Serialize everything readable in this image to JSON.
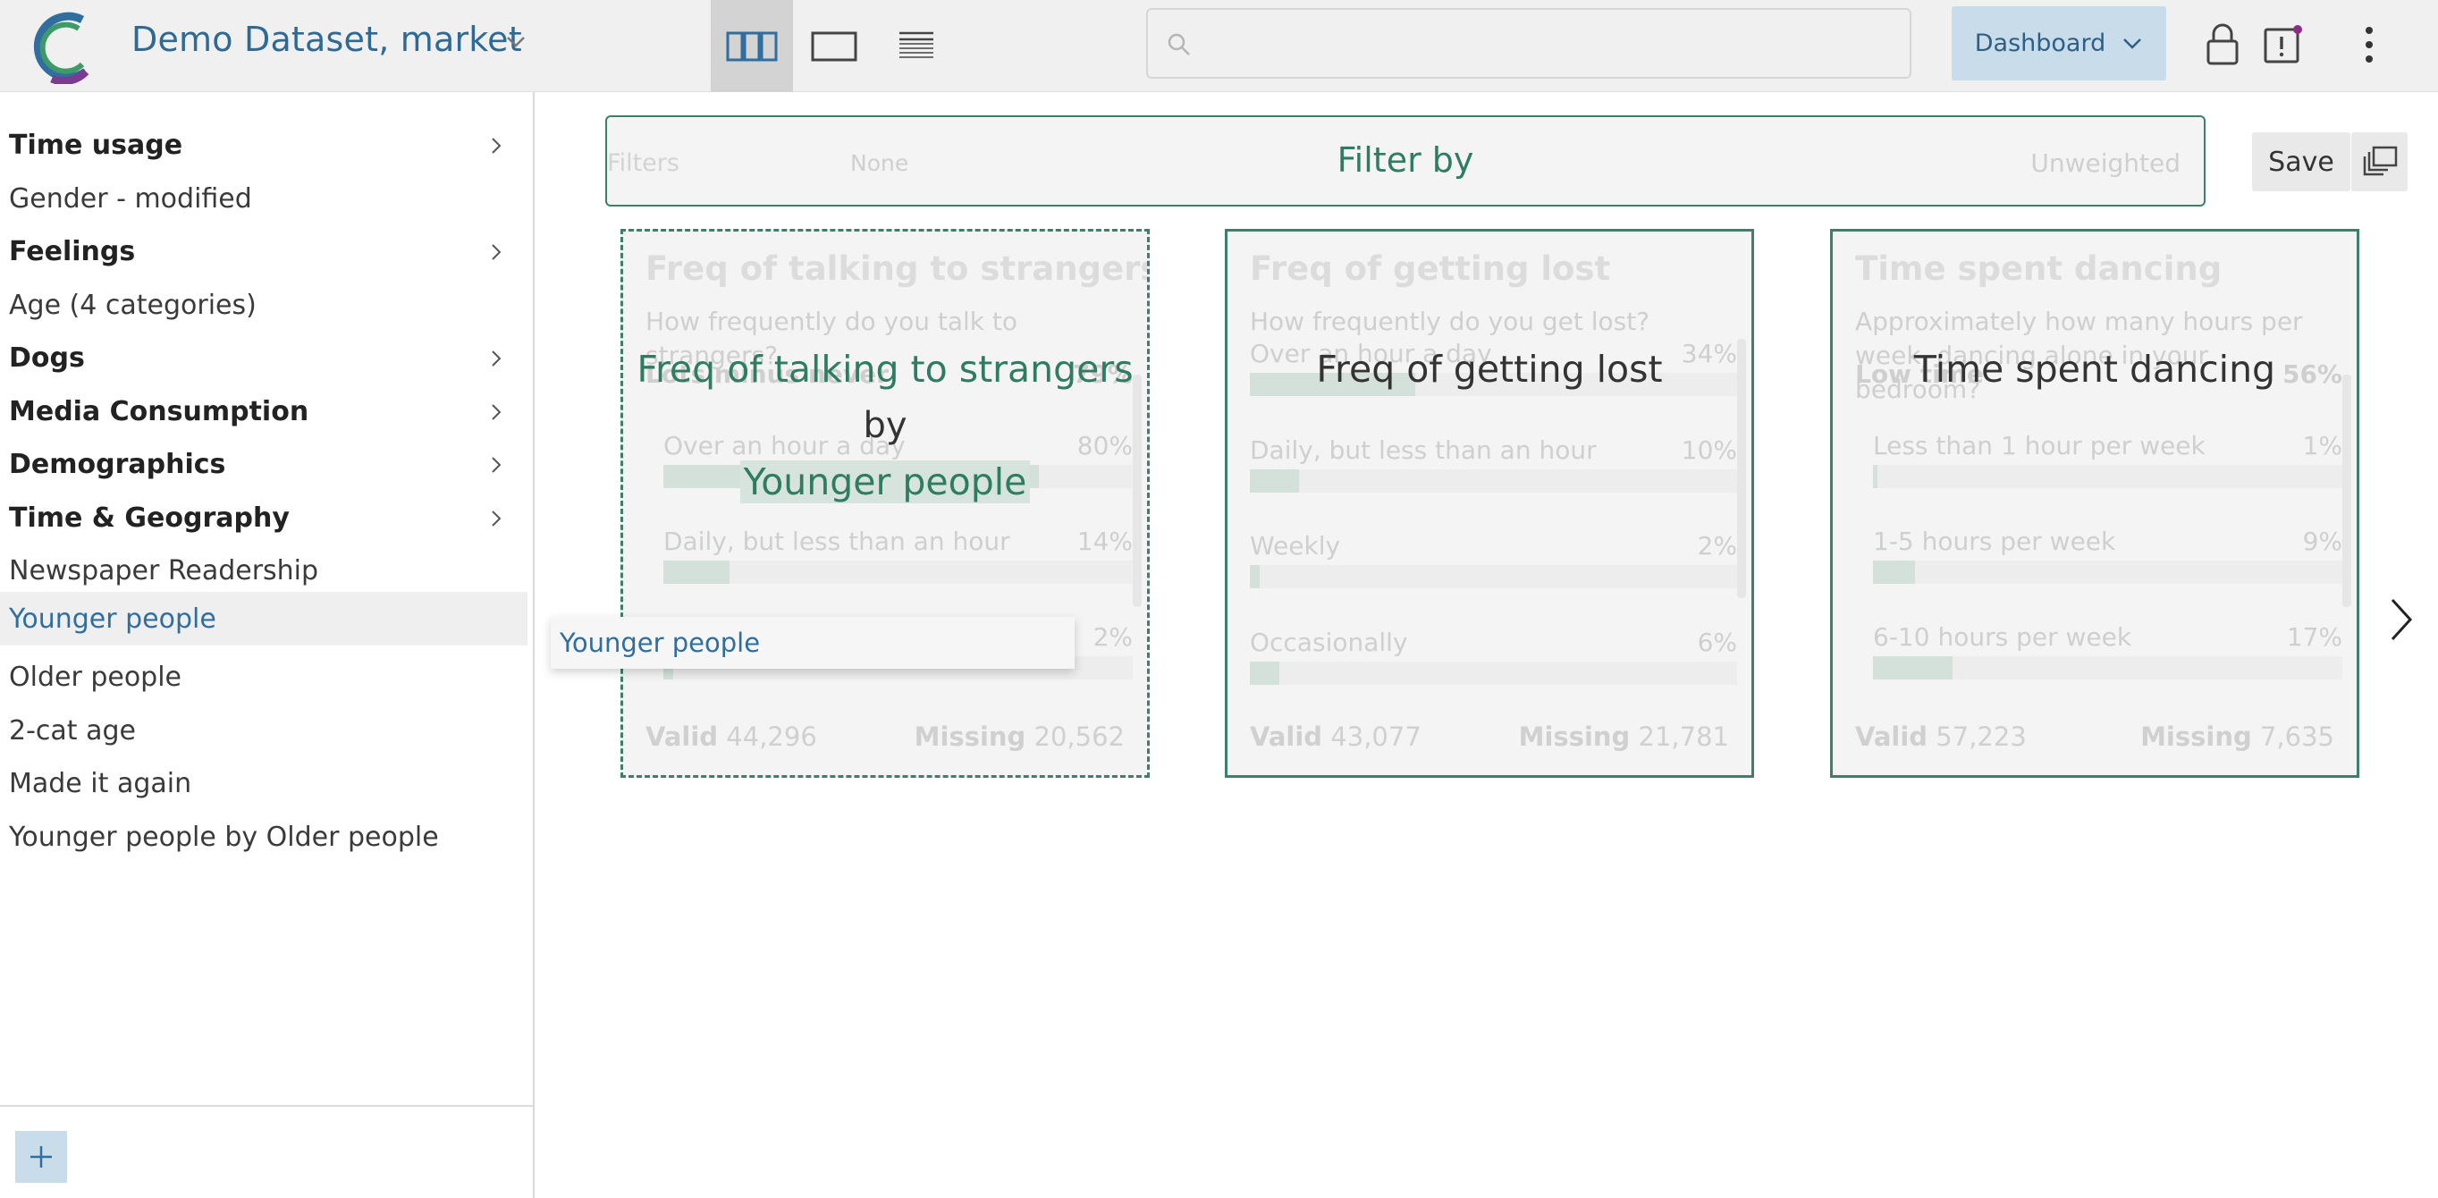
{
  "header": {
    "dataset_name": "Demo Dataset, market",
    "search_placeholder": "",
    "mode_button": "Dashboard",
    "view_modes": [
      "grid-view",
      "single-view",
      "list-view"
    ]
  },
  "sidebar": {
    "items": [
      {
        "label": "Time usage",
        "group": true
      },
      {
        "label": "Gender - modified",
        "group": false
      },
      {
        "label": "Feelings",
        "group": true
      },
      {
        "label": "Age (4 categories)",
        "group": false
      },
      {
        "label": "Dogs",
        "group": true
      },
      {
        "label": "Media Consumption",
        "group": true
      },
      {
        "label": "Demographics",
        "group": true
      },
      {
        "label": "Time & Geography",
        "group": true
      },
      {
        "label": "Newspaper Readership",
        "group": false
      },
      {
        "label": "Younger people",
        "group": false,
        "selected": true
      },
      {
        "label": "Older people",
        "group": false
      },
      {
        "label": "2-cat age",
        "group": false
      },
      {
        "label": "Made it again",
        "group": false
      },
      {
        "label": "Younger people by Older people",
        "group": false
      }
    ]
  },
  "filter_bar": {
    "filters_label": "Filters",
    "filters_value": "None",
    "drop_hint": "Filter by",
    "weight": "Unweighted"
  },
  "toolbar": {
    "save_label": "Save"
  },
  "cards": [
    {
      "title": "Freq of talking to strangers",
      "question": "How frequently do you talk to strangers?",
      "rows": [
        {
          "label": "Lots minus never",
          "pct": "79%",
          "head": true,
          "fill": 0
        },
        {
          "label": "Over an hour a day",
          "pct": "80%",
          "fill": 0.8
        },
        {
          "label": "Daily, but less than an hour",
          "pct": "14%",
          "fill": 0.14
        },
        {
          "label": "",
          "pct": "2%",
          "fill": 0.02
        }
      ],
      "valid_label": "Valid",
      "valid_value": "44,296",
      "missing_label": "Missing",
      "missing_value": "20,562",
      "overlay_title": "Freq of talking to strangers",
      "overlay_by": "by",
      "overlay_var": "Younger people"
    },
    {
      "title": "Freq of getting lost",
      "question": "How frequently do you get lost?",
      "rows": [
        {
          "label": "Over an hour a day",
          "pct": "34%",
          "fill": 0.34
        },
        {
          "label": "Daily, but less than an hour",
          "pct": "10%",
          "fill": 0.1
        },
        {
          "label": "Weekly",
          "pct": "2%",
          "fill": 0.02
        },
        {
          "label": "Occasionally",
          "pct": "6%",
          "fill": 0.06
        }
      ],
      "valid_label": "Valid",
      "valid_value": "43,077",
      "missing_label": "Missing",
      "missing_value": "21,781",
      "overlay_title": "Freq of getting lost"
    },
    {
      "title": "Time spent dancing",
      "question": "Approximately how many hours per week, dancing alone in your bedroom?",
      "rows": [
        {
          "label": "Low time",
          "pct": "56%",
          "head": true,
          "fill": 0
        },
        {
          "label": "Less than 1 hour per week",
          "pct": "1%",
          "fill": 0.01
        },
        {
          "label": "1-5 hours per week",
          "pct": "9%",
          "fill": 0.09
        },
        {
          "label": "6-10 hours per week",
          "pct": "17%",
          "fill": 0.17
        }
      ],
      "valid_label": "Valid",
      "valid_value": "57,223",
      "missing_label": "Missing",
      "missing_value": "7,635",
      "overlay_title": "Time spent dancing"
    }
  ],
  "drag_ghost": {
    "label": "Younger people"
  },
  "colors": {
    "accent_blue": "#2d6a96",
    "accent_green": "#2e7c61",
    "card_border": "#3c8068",
    "button_blue_bg": "#c9dcea"
  }
}
